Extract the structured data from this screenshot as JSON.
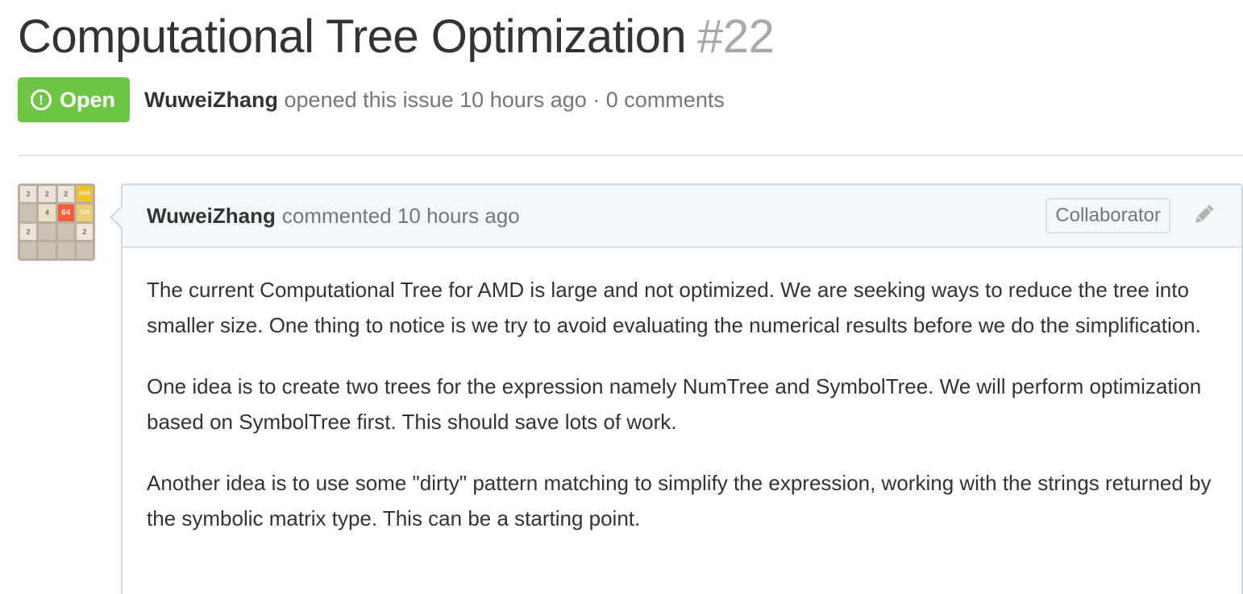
{
  "issue": {
    "title": "Computational Tree Optimization",
    "number": "#22",
    "state": "Open",
    "state_icon": "issue-opened-icon",
    "author": "WuweiZhang",
    "meta_text": "opened this issue 10 hours ago · 0 comments"
  },
  "colors": {
    "open_green": "#6cc644",
    "comment_border": "#cad8e4",
    "comment_header_bg": "#f2f8fa"
  },
  "avatar": {
    "tiles": [
      "2",
      "2",
      "2",
      "2048",
      "",
      "4",
      "64",
      "128",
      "2",
      "",
      "",
      "2",
      "",
      "",
      "",
      ""
    ]
  },
  "comment": {
    "author": "WuweiZhang",
    "timestamp": "commented 10 hours ago",
    "role": "Collaborator",
    "edit_icon": "pencil-icon",
    "paragraphs": [
      "The current Computational Tree for AMD is large and not optimized. We are seeking ways to reduce the tree into smaller size. One thing to notice is we try to avoid evaluating the numerical results before we do the simplification.",
      "One idea is to create two trees for the expression namely NumTree and SymbolTree. We will perform optimization based on SymbolTree first. This should save lots of work.",
      "Another idea is to use some \"dirty\" pattern matching to simplify the expression, working with the strings returned by the symbolic matrix type. This can be a starting point."
    ]
  }
}
